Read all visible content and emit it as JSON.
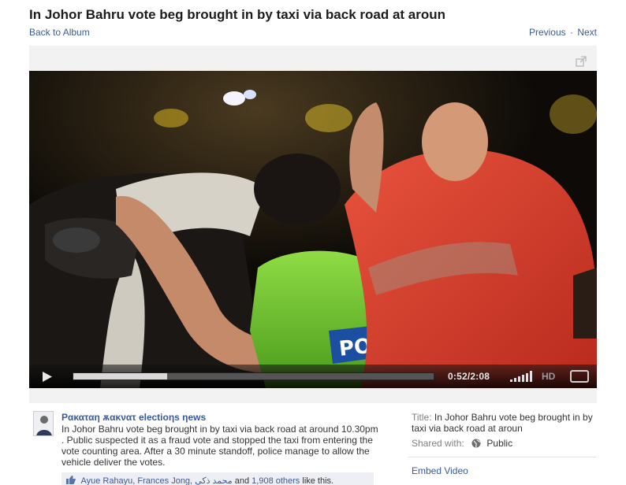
{
  "header": {
    "title": "In Johor Bahru vote beg brought in by taxi via back road at aroun",
    "back_label": "Back to Album",
    "previous_label": "Previous",
    "separator": "·",
    "next_label": "Next"
  },
  "player": {
    "time": "0:52/2:08",
    "hd_label": "HD",
    "progress": 0.26,
    "icons": [
      "expand-icon",
      "play-icon",
      "volume-icon",
      "fullscreen-icon"
    ]
  },
  "post": {
    "page_name": "Ρακαταη ѫακνατ еlесtіοηs ηеws",
    "description": "In Johor Bahru vote beg brought in by taxi via back road at around 10.30pm . Public suspected it as a fraud vote and stopped the taxi from entering the vote counting area. After a 30 minute standoff, police manage to allow the vehicle deliver the votes.",
    "likers": "Ayue Rahayu, Frances Jong, محمد ذكي",
    "likes_and": "and",
    "others": "1,908 others",
    "likes_suffix": "like this."
  },
  "sidebar": {
    "title_label": "Title:",
    "title_value": "In Johor Bahru vote beg brought in by taxi via back road at aroun",
    "shared_label": "Shared with:",
    "shared_value": "Public",
    "embed_label": "Embed Video"
  },
  "colors": {
    "link": "#3b5998",
    "video_bg": "#0e0b08",
    "likes_bg": "#edeff4"
  }
}
